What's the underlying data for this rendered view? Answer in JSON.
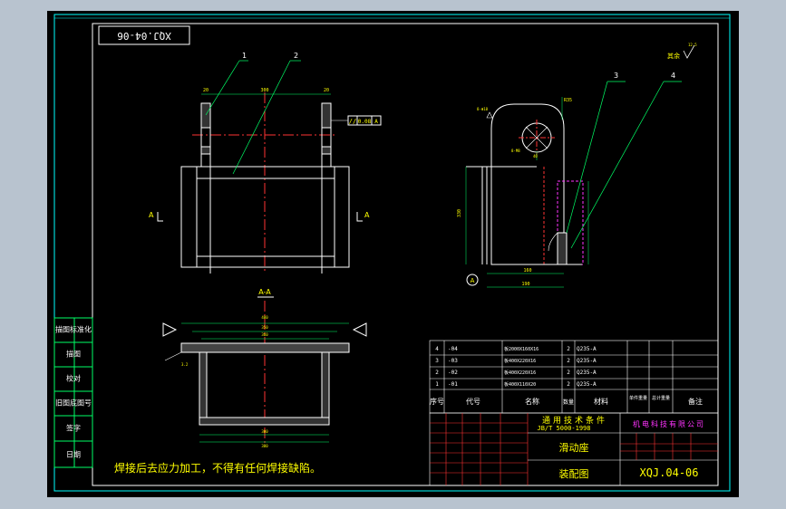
{
  "drawing": {
    "code_rotated": "XQJ.04-06",
    "note": "焊接后去应力加工，不得有任何焊接缺陷。",
    "balloons": [
      "1",
      "2",
      "3",
      "4"
    ],
    "section_mark": "A",
    "section_title": "A-A",
    "surface_finish": "其余",
    "surface_value": "12.5",
    "gdt_symbol": "//",
    "gdt_value": "0.08",
    "gdt_datum": "A"
  },
  "left_column": [
    "描图标准化",
    "描图",
    "校对",
    "旧图底图号",
    "签字",
    "日期"
  ],
  "parts_list": {
    "headers": [
      "序号",
      "代号",
      "名称",
      "数量",
      "材料",
      "单件重量",
      "总计重量",
      "备注"
    ],
    "rows": [
      {
        "no": "4",
        "code": "-04",
        "name": "板2000X160X16",
        "qty": "2",
        "material": "Q235-A"
      },
      {
        "no": "3",
        "code": "-03",
        "name": "板400X220X16",
        "qty": "2",
        "material": "Q235-A"
      },
      {
        "no": "2",
        "code": "-02",
        "name": "板400X220X16",
        "qty": "2",
        "material": "Q235-A"
      },
      {
        "no": "1",
        "code": "-01",
        "name": "板400X110X20",
        "qty": "2",
        "material": "Q235-A"
      }
    ]
  },
  "title_block": {
    "standard": "通用技术条件",
    "standard_code": "JB/T 5000-1998",
    "company": "机电科技有限公司",
    "part_name": "滑动座",
    "drawing_type": "装配图",
    "drawing_no": "XQJ.04-06"
  }
}
